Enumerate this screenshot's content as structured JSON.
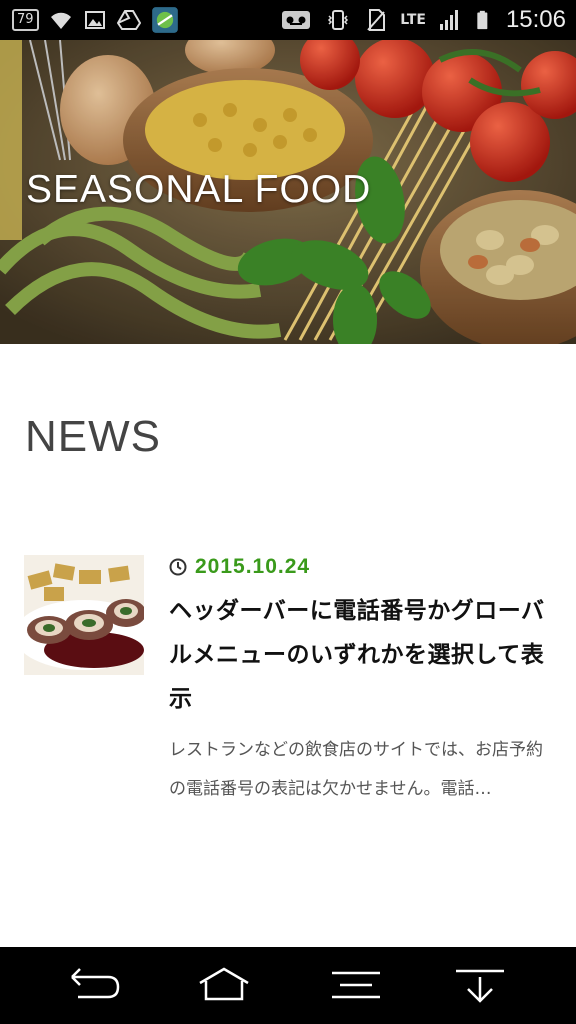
{
  "status_bar": {
    "battery_text": "79",
    "network_label": "LTE",
    "time": "15:06"
  },
  "hero": {
    "title": "SEASONAL FOOD"
  },
  "news": {
    "heading": "NEWS",
    "posts": [
      {
        "date": "2015.10.24",
        "title": "ヘッダーバーに電話番号かグローバルメニューのいずれかを選択して表示",
        "excerpt": "レストランなどの飲食店のサイトでは、お店予約の電話番号の表記は欠かせません。電話…"
      }
    ]
  },
  "colors": {
    "accent": "#3a9a1b",
    "heading": "#444444",
    "status_bar": "#000000"
  },
  "icons": [
    "battery-icon",
    "wifi-icon",
    "image-icon",
    "drive-icon",
    "app-icon",
    "voicemail-icon",
    "vibrate-icon",
    "no-sim-icon",
    "signal-icon",
    "battery-full-icon",
    "clock-icon",
    "back-icon",
    "home-icon",
    "menu-icon",
    "download-icon"
  ]
}
